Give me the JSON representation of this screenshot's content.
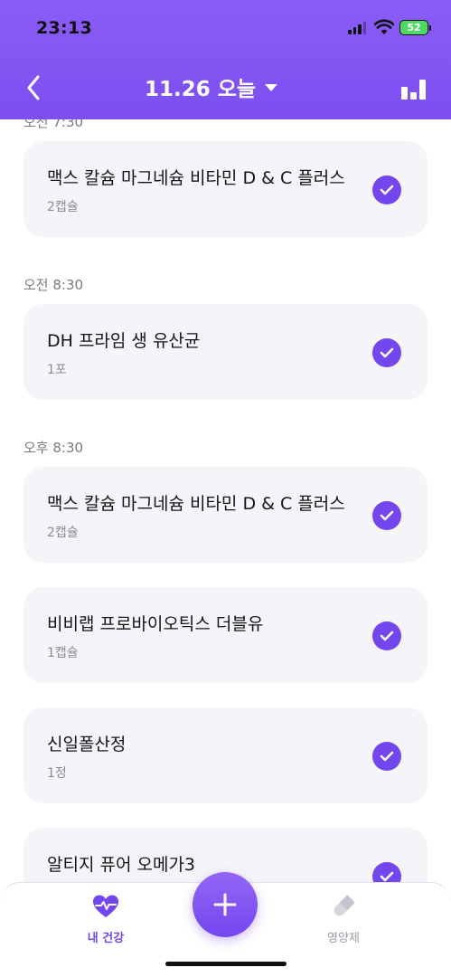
{
  "status_bar": {
    "time": "23:13",
    "battery": "52"
  },
  "header": {
    "date_title": "11.26 오늘"
  },
  "schedule": {
    "partial_time_label": "오전 7:30",
    "group_time_1": "오전 8:30",
    "group_time_2": "오후 8:30",
    "items": [
      {
        "name": "맥스 칼슘 마그네슘 비타민 D & C 플러스",
        "dose": "2캡슐",
        "checked": true
      },
      {
        "name": "DH 프라임 생 유산균",
        "dose": "1포",
        "checked": true
      },
      {
        "name": "맥스 칼슘 마그네슘 비타민 D & C 플러스",
        "dose": "2캡슐",
        "checked": true
      },
      {
        "name": "비비랩 프로바이오틱스 더블유",
        "dose": "1캡슐",
        "checked": true
      },
      {
        "name": "신일폴산정",
        "dose": "1정",
        "checked": true
      },
      {
        "name": "알티지 퓨어 오메가3",
        "dose": "",
        "checked": true
      }
    ]
  },
  "tabbar": {
    "health_label": "내 건강",
    "supplements_label": "영양제"
  },
  "colors": {
    "accent": "#7446ee",
    "header": "#8b5cf6",
    "card": "#f5f5f9"
  }
}
